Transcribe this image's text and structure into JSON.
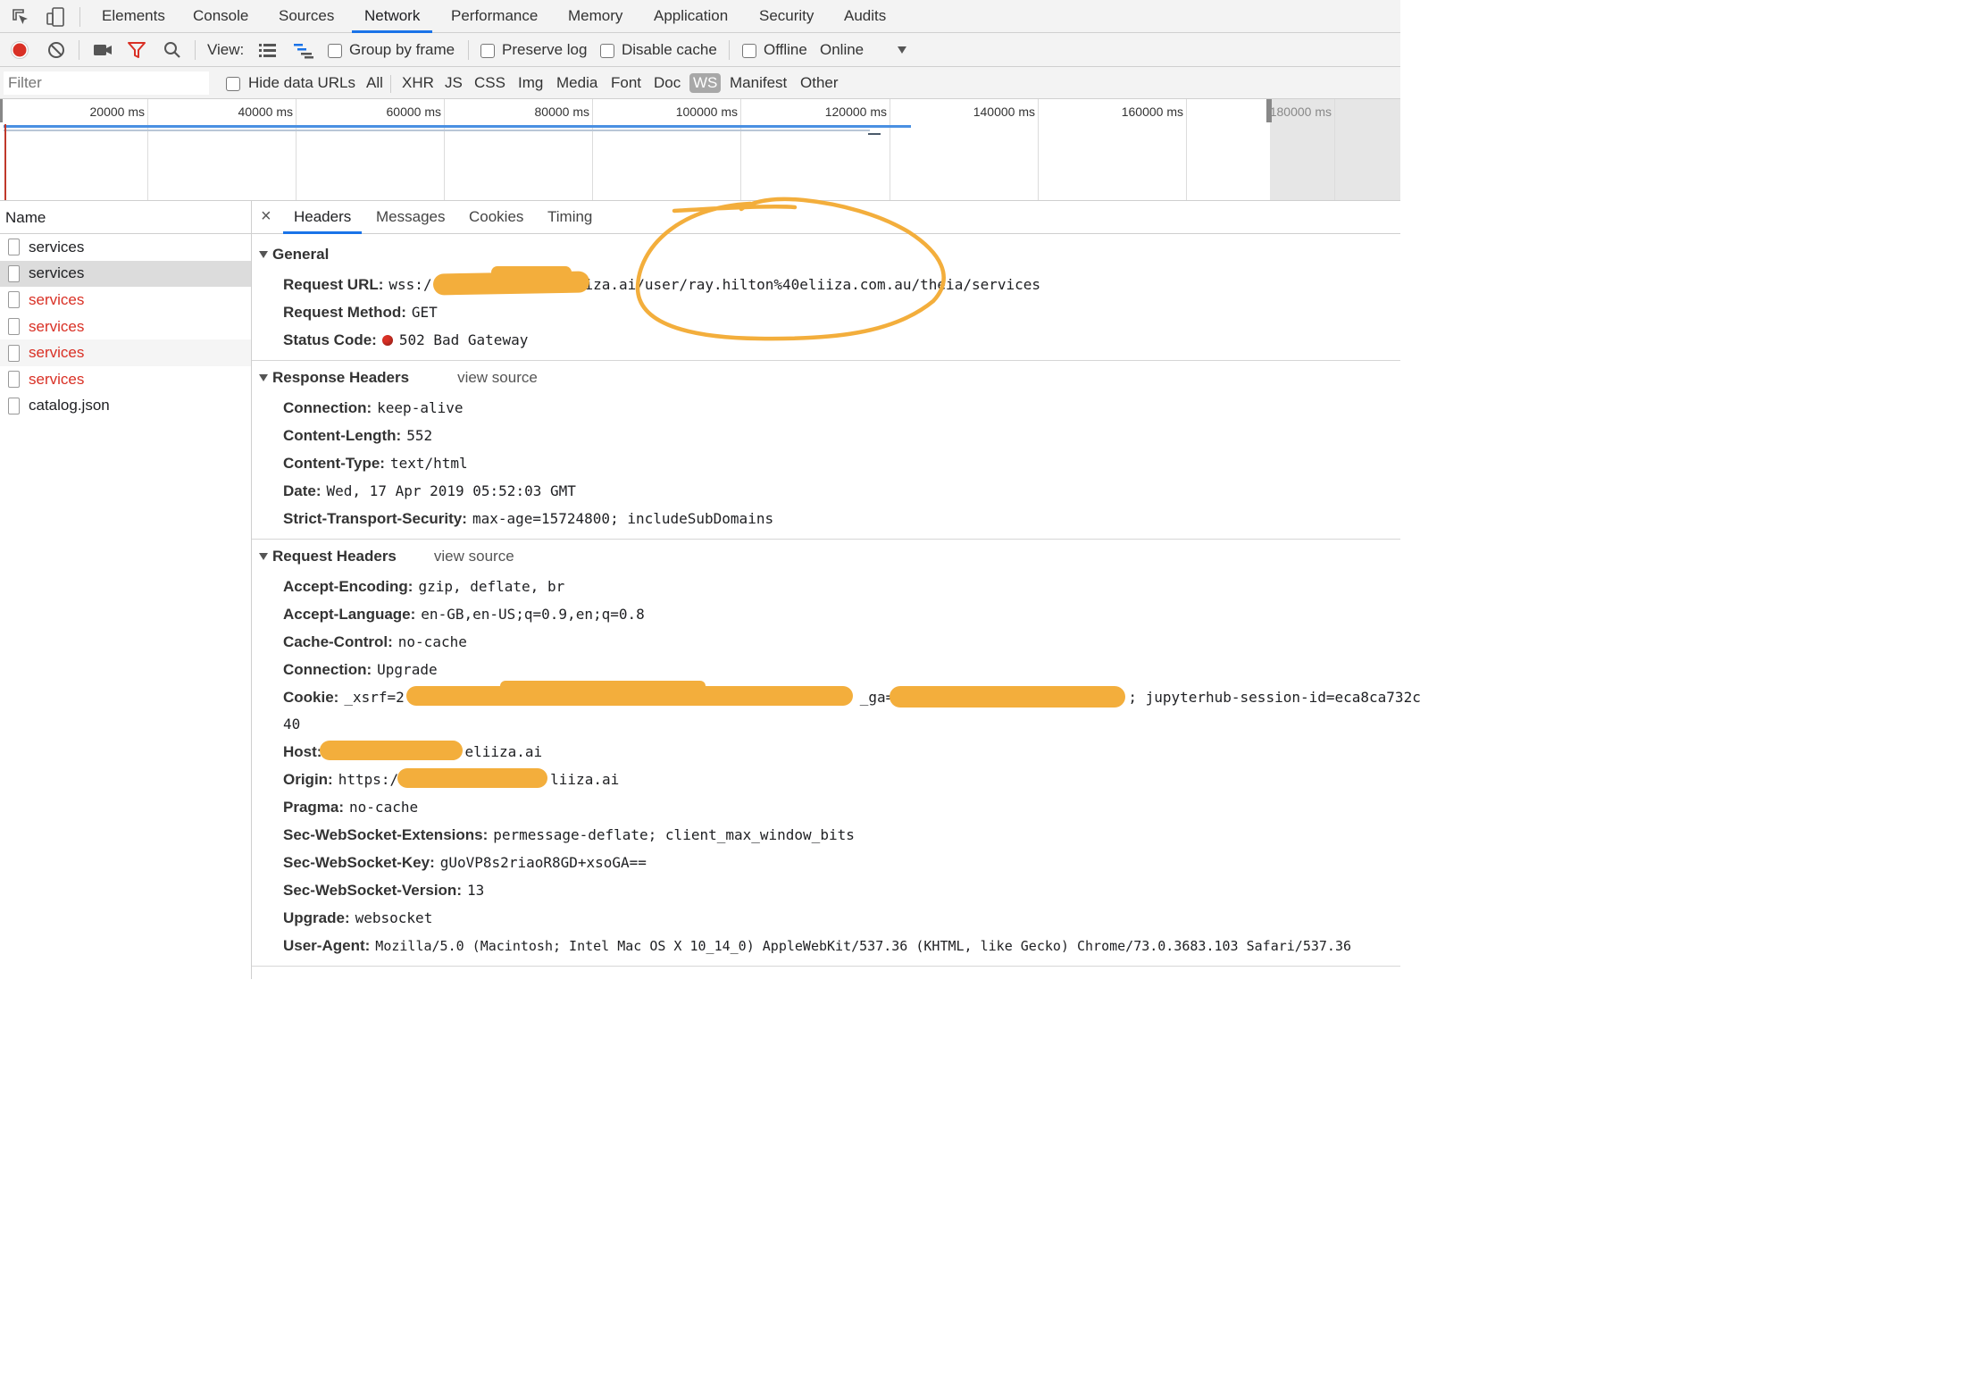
{
  "tabs": [
    "Elements",
    "Console",
    "Sources",
    "Network",
    "Performance",
    "Memory",
    "Application",
    "Security",
    "Audits"
  ],
  "toolbar": {
    "view_label": "View:",
    "group_by_frame": "Group by frame",
    "preserve_log": "Preserve log",
    "disable_cache": "Disable cache",
    "offline": "Offline",
    "throttle": "Online"
  },
  "filter": {
    "placeholder": "Filter",
    "hide_data_urls": "Hide data URLs",
    "types": [
      "All",
      "XHR",
      "JS",
      "CSS",
      "Img",
      "Media",
      "Font",
      "Doc",
      "WS",
      "Manifest",
      "Other"
    ],
    "selected": "WS"
  },
  "timeline": {
    "ticks": [
      "20000 ms",
      "40000 ms",
      "60000 ms",
      "80000 ms",
      "100000 ms",
      "120000 ms",
      "140000 ms",
      "160000 ms",
      "180000 ms"
    ]
  },
  "requests": {
    "header": "Name",
    "items": [
      {
        "name": "services",
        "error": false
      },
      {
        "name": "services",
        "error": false
      },
      {
        "name": "services",
        "error": true
      },
      {
        "name": "services",
        "error": true
      },
      {
        "name": "services",
        "error": true
      },
      {
        "name": "services",
        "error": true
      },
      {
        "name": "catalog.json",
        "error": false
      }
    ]
  },
  "detail": {
    "tabs": [
      "Headers",
      "Messages",
      "Cookies",
      "Timing"
    ],
    "view_source": "view source",
    "general": {
      "title": "General",
      "request_url_key": "Request URL:",
      "request_url_prefix": "wss:/",
      "request_url_value": "eliiza.ai/user/ray.hilton%40eliiza.com.au/theia/services",
      "request_method_key": "Request Method:",
      "request_method_value": "GET",
      "status_code_key": "Status Code:",
      "status_code_value": "502 Bad Gateway"
    },
    "response_headers": {
      "title": "Response Headers",
      "items": [
        {
          "k": "Connection:",
          "v": "keep-alive"
        },
        {
          "k": "Content-Length:",
          "v": "552"
        },
        {
          "k": "Content-Type:",
          "v": "text/html"
        },
        {
          "k": "Date:",
          "v": "Wed, 17 Apr 2019 05:52:03 GMT"
        },
        {
          "k": "Strict-Transport-Security:",
          "v": "max-age=15724800; includeSubDomains"
        }
      ]
    },
    "request_headers": {
      "title": "Request Headers",
      "items": [
        {
          "k": "Accept-Encoding:",
          "v": "gzip, deflate, br"
        },
        {
          "k": "Accept-Language:",
          "v": "en-GB,en-US;q=0.9,en;q=0.8"
        },
        {
          "k": "Cache-Control:",
          "v": "no-cache"
        },
        {
          "k": "Connection:",
          "v": "Upgrade"
        }
      ],
      "cookie_key": "Cookie:",
      "cookie_part1": "_xsrf=2",
      "cookie_part2": "_ga=",
      "cookie_part3": "; jupyterhub-session-id=eca8ca732c",
      "cookie_wrap": "40",
      "host_key": "Host:",
      "host_value": "eliiza.ai",
      "origin_key": "Origin:",
      "origin_prefix": "https:/",
      "origin_value": "liiza.ai",
      "items2": [
        {
          "k": "Pragma:",
          "v": "no-cache"
        },
        {
          "k": "Sec-WebSocket-Extensions:",
          "v": "permessage-deflate; client_max_window_bits"
        },
        {
          "k": "Sec-WebSocket-Key:",
          "v": "gUoVP8s2riaoR8GD+xsoGA=="
        },
        {
          "k": "Sec-WebSocket-Version:",
          "v": "13"
        },
        {
          "k": "Upgrade:",
          "v": "websocket"
        },
        {
          "k": "User-Agent:",
          "v": "Mozilla/5.0 (Macintosh; Intel Mac OS X 10_14_0) AppleWebKit/537.36 (KHTML, like Gecko) Chrome/73.0.3683.103 Safari/537.36"
        }
      ]
    }
  },
  "colors": {
    "accent": "#1a73e8",
    "error": "#d93025",
    "annotation": "#f3ae3c"
  }
}
